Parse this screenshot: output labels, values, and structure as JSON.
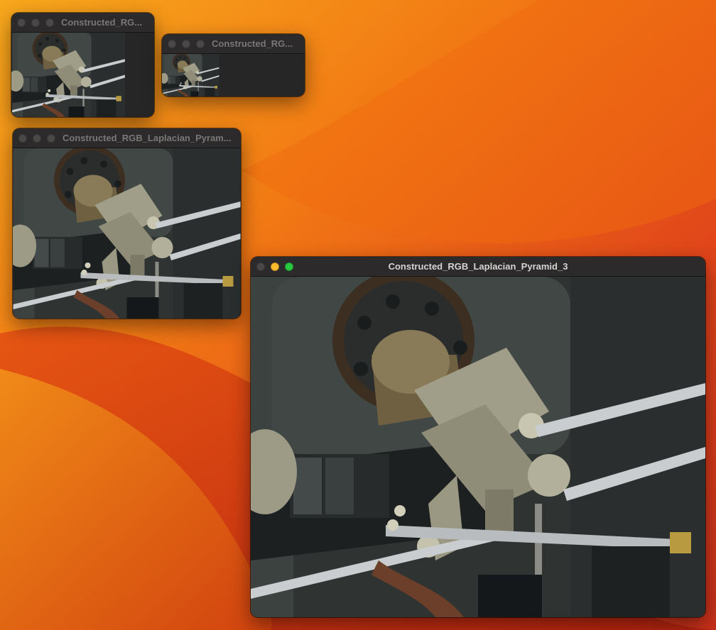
{
  "desktop": {
    "wallpaper_colors": [
      "#f7a21b",
      "#f06012",
      "#c72a14",
      "#8a160c"
    ]
  },
  "windows": [
    {
      "id": "pyramid_0",
      "title": "Constructed_RG...",
      "active": false
    },
    {
      "id": "pyramid_1",
      "title": "Constructed_RG...",
      "active": false
    },
    {
      "id": "pyramid_2",
      "title": "Constructed_RGB_Laplacian_Pyram...",
      "active": false
    },
    {
      "id": "pyramid_3",
      "title": "Constructed_RGB_Laplacian_Pyramid_3",
      "active": true
    }
  ],
  "photo_palette": {
    "metal": "#a09e88",
    "dark": "#2f3433",
    "brass": "#6e6040",
    "rod": "#c9cdd0",
    "shadow": "#15181a"
  }
}
